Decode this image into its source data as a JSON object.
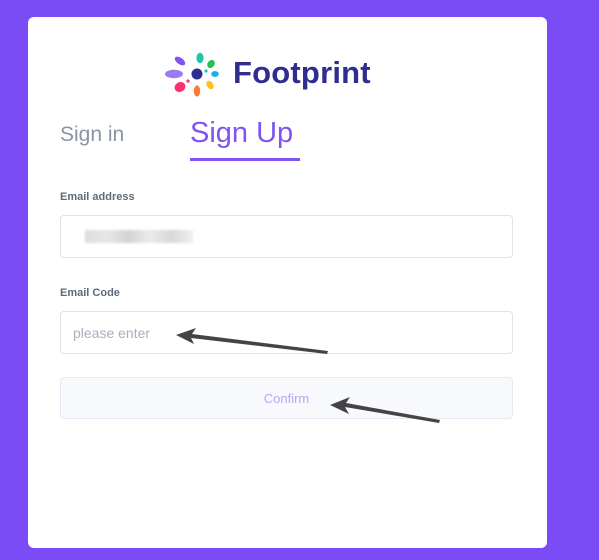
{
  "brand": {
    "name": "Footprint",
    "logo_icon": "flower-logo-icon",
    "colors": {
      "brand_text": "#2f2d8f",
      "accent": "#7f54f0",
      "background": "#7a4cf5"
    }
  },
  "tabs": [
    {
      "label": "Sign in",
      "active": false
    },
    {
      "label": "Sign Up",
      "active": true
    }
  ],
  "form": {
    "email": {
      "label": "Email address",
      "value_redacted": true
    },
    "code": {
      "label": "Email Code",
      "placeholder": "please enter",
      "value": ""
    },
    "confirm_label": "Confirm"
  },
  "annotations": {
    "icon": "arrow-annotation-icon",
    "color": "#444444"
  }
}
